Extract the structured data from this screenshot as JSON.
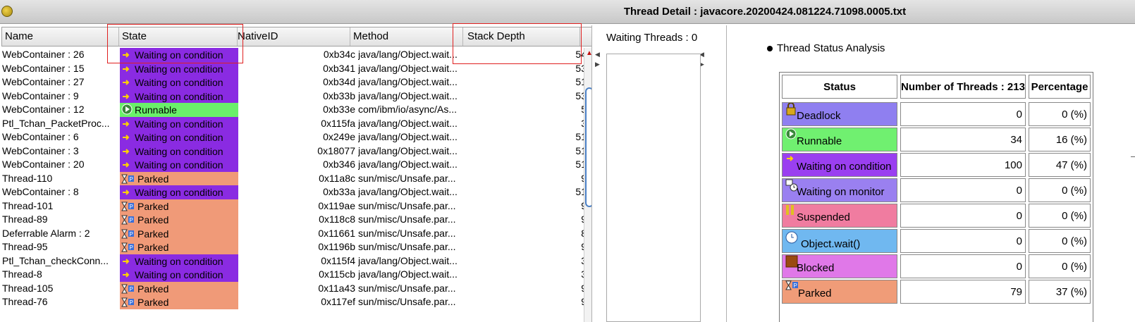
{
  "window": {
    "title": "Thread Detail : javacore.20200424.081224.71098.0005.txt"
  },
  "thread_table": {
    "columns": [
      "Name",
      "State",
      "NativeID",
      "Method",
      "Stack Depth"
    ],
    "rows": [
      {
        "name": "WebContainer : 26",
        "state": "Waiting on condition",
        "native": "0xb34c",
        "method": "java/lang/Object.wait...",
        "depth": "54"
      },
      {
        "name": "WebContainer : 15",
        "state": "Waiting on condition",
        "native": "0xb341",
        "method": "java/lang/Object.wait...",
        "depth": "53"
      },
      {
        "name": "WebContainer : 27",
        "state": "Waiting on condition",
        "native": "0xb34d",
        "method": "java/lang/Object.wait...",
        "depth": "51"
      },
      {
        "name": "WebContainer : 9",
        "state": "Waiting on condition",
        "native": "0xb33b",
        "method": "java/lang/Object.wait...",
        "depth": "53"
      },
      {
        "name": "WebContainer : 12",
        "state": "Runnable",
        "native": "0xb33e",
        "method": "com/ibm/io/async/As...",
        "depth": "5"
      },
      {
        "name": "Ptl_Tchan_PacketProc...",
        "state": "Waiting on condition",
        "native": "0x115fa",
        "method": "java/lang/Object.wait...",
        "depth": "3"
      },
      {
        "name": "WebContainer : 6",
        "state": "Waiting on condition",
        "native": "0x249e",
        "method": "java/lang/Object.wait...",
        "depth": "51"
      },
      {
        "name": "WebContainer : 3",
        "state": "Waiting on condition",
        "native": "0x18077",
        "method": "java/lang/Object.wait...",
        "depth": "51"
      },
      {
        "name": "WebContainer : 20",
        "state": "Waiting on condition",
        "native": "0xb346",
        "method": "java/lang/Object.wait...",
        "depth": "51"
      },
      {
        "name": "Thread-110",
        "state": "Parked",
        "native": "0x11a8c",
        "method": "sun/misc/Unsafe.par...",
        "depth": "9"
      },
      {
        "name": "WebContainer : 8",
        "state": "Waiting on condition",
        "native": "0xb33a",
        "method": "java/lang/Object.wait...",
        "depth": "51"
      },
      {
        "name": "Thread-101",
        "state": "Parked",
        "native": "0x119ae",
        "method": "sun/misc/Unsafe.par...",
        "depth": "9"
      },
      {
        "name": "Thread-89",
        "state": "Parked",
        "native": "0x118c8",
        "method": "sun/misc/Unsafe.par...",
        "depth": "9"
      },
      {
        "name": "Deferrable Alarm : 2",
        "state": "Parked",
        "native": "0x11661",
        "method": "sun/misc/Unsafe.par...",
        "depth": "8"
      },
      {
        "name": "Thread-95",
        "state": "Parked",
        "native": "0x1196b",
        "method": "sun/misc/Unsafe.par...",
        "depth": "9"
      },
      {
        "name": "Ptl_Tchan_checkConn...",
        "state": "Waiting on condition",
        "native": "0x115f4",
        "method": "java/lang/Object.wait...",
        "depth": "3"
      },
      {
        "name": "Thread-8",
        "state": "Waiting on condition",
        "native": "0x115cb",
        "method": "java/lang/Object.wait...",
        "depth": "3"
      },
      {
        "name": "Thread-105",
        "state": "Parked",
        "native": "0x11a43",
        "method": "sun/misc/Unsafe.par...",
        "depth": "9"
      },
      {
        "name": "Thread-76",
        "state": "Parked",
        "native": "0x117ef",
        "method": "sun/misc/Unsafe.par...",
        "depth": "9"
      }
    ]
  },
  "waiting": {
    "label": "Waiting Threads : 0"
  },
  "analysis": {
    "title": "Thread Status Analysis",
    "headers": [
      "Status",
      "Number of Threads : 213",
      "Percentage"
    ],
    "rows": [
      {
        "status": "Deadlock",
        "count": "0",
        "pct": "0 (%)",
        "color": "#8f7ff0",
        "icon": "lock-icon"
      },
      {
        "status": "Runnable",
        "count": "34",
        "pct": "16 (%)",
        "color": "#70f070",
        "icon": "runnable-icon"
      },
      {
        "status": "Waiting on condition",
        "count": "100",
        "pct": "47 (%)",
        "color": "#9a3ff0",
        "icon": "arrow-icon"
      },
      {
        "status": "Waiting on monitor",
        "count": "0",
        "pct": "0 (%)",
        "color": "#9a80f0",
        "icon": "monitor-icon"
      },
      {
        "status": "Suspended",
        "count": "0",
        "pct": "0 (%)",
        "color": "#f07ca0",
        "icon": "pause-icon"
      },
      {
        "status": "Object.wait()",
        "count": "0",
        "pct": "0 (%)",
        "color": "#70b8f0",
        "icon": "clock-icon"
      },
      {
        "status": "Blocked",
        "count": "0",
        "pct": "0 (%)",
        "color": "#e078e8",
        "icon": "blocked-icon"
      },
      {
        "status": "Parked",
        "count": "79",
        "pct": "37 (%)",
        "color": "#f09c78",
        "icon": "hourglass-icon"
      }
    ]
  },
  "state_colors": {
    "Waiting on condition": "#8a2be2",
    "Runnable": "#6af06a",
    "Parked": "#f09a78"
  }
}
